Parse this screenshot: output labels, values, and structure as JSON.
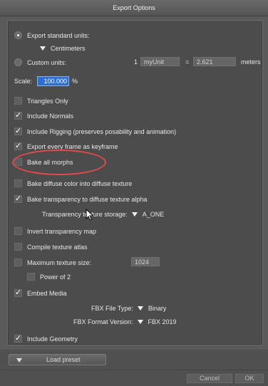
{
  "window": {
    "title": "Export Options"
  },
  "units": {
    "standard_label": "Export standard units:",
    "standard_value": "Centimeters",
    "custom_label": "Custom units:",
    "custom_count": "1",
    "custom_name": "myUnit",
    "equals": "=",
    "custom_factor": "2.621",
    "meters": "meters"
  },
  "scale": {
    "label": "Scale:",
    "value": "100.000",
    "unit": "%"
  },
  "options": {
    "triangles_only": "Triangles Only",
    "include_normals": "Include Normals",
    "include_rigging": "Include Rigging (preserves posability and animation)",
    "export_keyframe": "Export every frame as keyframe",
    "bake_morphs": "Bake all morphs",
    "bake_diffuse": "Bake diffuse color into diffuse texture",
    "bake_transparency": "Bake transparency to diffuse texture alpha",
    "transparency_storage_label": "Transparency texture storage:",
    "transparency_storage_value": "A_ONE",
    "invert_transparency": "Invert transparency map",
    "compile_atlas": "Compile texture atlas",
    "max_texture_label": "Maximum texture size:",
    "max_texture_value": "1024",
    "power_of_2": "Power of 2",
    "embed_media": "Embed Media",
    "fbx_file_type_label": "FBX File Type:",
    "fbx_file_type_value": "Binary",
    "fbx_format_label": "FBX Format Version:",
    "fbx_format_value": "FBX 2019",
    "include_geometry": "Include Geometry"
  },
  "footer": {
    "load_preset": "Load preset",
    "cancel": "Cancel",
    "ok": "OK"
  },
  "colors": {
    "annotation": "#e34a4a",
    "selection": "#2d6fd1"
  }
}
